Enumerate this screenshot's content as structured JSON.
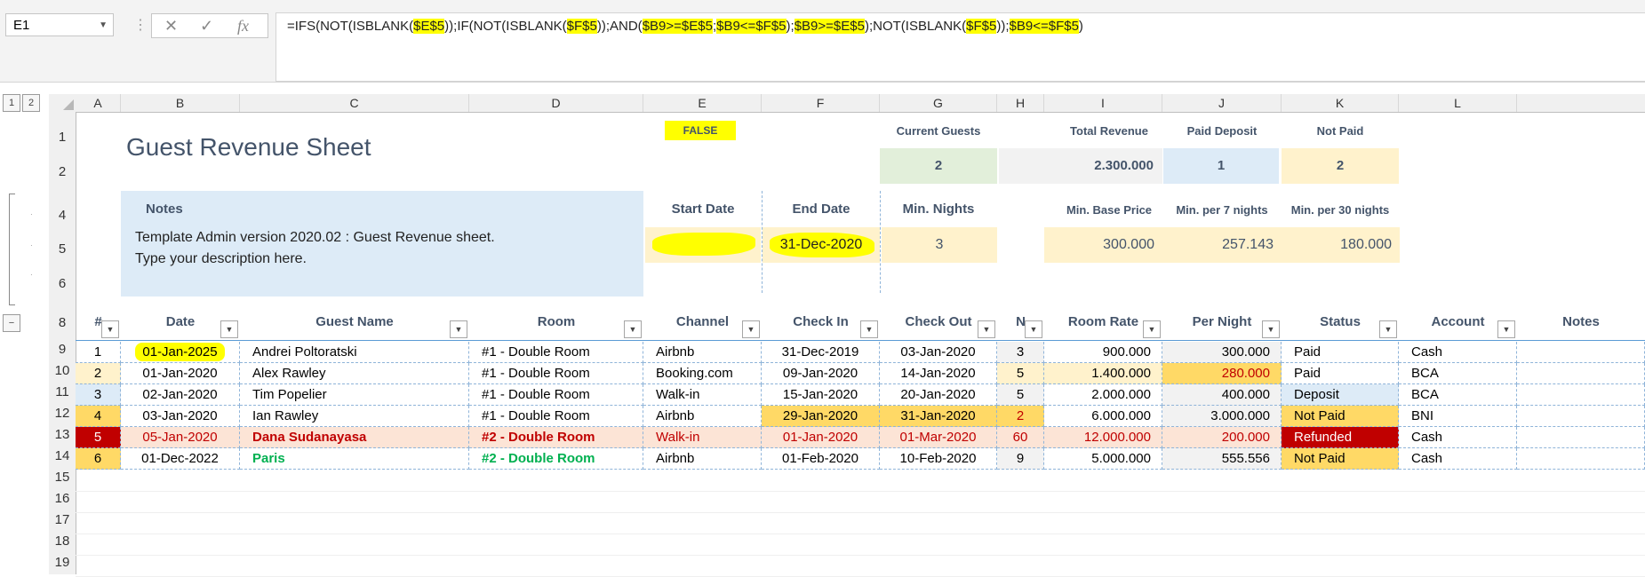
{
  "name_box": "E1",
  "formula_parts": [
    {
      "t": "=IFS(NOT(ISBLANK(",
      "h": false
    },
    {
      "t": "$E$5",
      "h": true
    },
    {
      "t": "));IF(NOT(ISBLANK(",
      "h": false
    },
    {
      "t": "$F$5",
      "h": true
    },
    {
      "t": "));AND(",
      "h": false
    },
    {
      "t": "$B9>=$E$5",
      "h": true
    },
    {
      "t": ";",
      "h": false
    },
    {
      "t": "$B9<=",
      "h": true
    },
    {
      "t": "$F$5",
      "h": true
    },
    {
      "t": ");",
      "h": false
    },
    {
      "t": "$B9>=$E$5",
      "h": true
    },
    {
      "t": ");NOT(ISBLANK(",
      "h": false
    },
    {
      "t": "$F$5",
      "h": true
    },
    {
      "t": "));",
      "h": false
    },
    {
      "t": "$B9<=$F$5",
      "h": true
    },
    {
      "t": ")",
      "h": false
    }
  ],
  "outline_levels": [
    "1",
    "2"
  ],
  "collapse_button": "−",
  "columns": [
    "A",
    "B",
    "C",
    "D",
    "E",
    "F",
    "G",
    "H",
    "I",
    "J",
    "K",
    "L"
  ],
  "rows": [
    "1",
    "2",
    "4",
    "5",
    "6",
    "8",
    "9",
    "10",
    "11",
    "12",
    "13",
    "14",
    "15",
    "16",
    "17",
    "18",
    "19"
  ],
  "sheet": {
    "title": "Guest Revenue Sheet",
    "false_flag": "FALSE",
    "summary": {
      "current_guests_label": "Current Guests",
      "current_guests": "2",
      "total_revenue_label": "Total Revenue",
      "total_revenue": "2.300.000",
      "paid_deposit_label": "Paid Deposit",
      "paid_deposit": "1",
      "not_paid_label": "Not Paid",
      "not_paid": "2"
    },
    "notes_label": "Notes",
    "notes_line1": "Template Admin version 2020.02 : Guest Revenue sheet.",
    "notes_line2": "Type your description here.",
    "start_date_label": "Start Date",
    "start_date": "",
    "end_date_label": "End Date",
    "end_date": "31-Dec-2020",
    "min_nights_label": "Min. Nights",
    "min_nights": "3",
    "min_base_price_label": "Min. Base Price",
    "min_base_price": "300.000",
    "min_7_label": "Min. per 7 nights",
    "min_7": "257.143",
    "min_30_label": "Min. per 30 nights",
    "min_30": "180.000"
  },
  "table": {
    "headers": [
      "#",
      "Date",
      "Guest Name",
      "Room",
      "Channel",
      "Check In",
      "Check Out",
      "N",
      "Room Rate",
      "Per Night",
      "Status",
      "Account",
      "Notes"
    ],
    "rows": [
      [
        "1",
        "01-Jan-2025",
        "Andrei Poltoratski",
        "#1 - Double Room",
        "Airbnb",
        "31-Dec-2019",
        "03-Jan-2020",
        "3",
        "900.000",
        "300.000",
        "Paid",
        "Cash",
        ""
      ],
      [
        "2",
        "01-Jan-2020",
        "Alex Rawley",
        "#1 - Double Room",
        "Booking.com",
        "09-Jan-2020",
        "14-Jan-2020",
        "5",
        "1.400.000",
        "280.000",
        "Paid",
        "BCA",
        ""
      ],
      [
        "3",
        "02-Jan-2020",
        "Tim Popelier",
        "#1 - Double Room",
        "Walk-in",
        "15-Jan-2020",
        "20-Jan-2020",
        "5",
        "2.000.000",
        "400.000",
        "Deposit",
        "BCA",
        ""
      ],
      [
        "4",
        "03-Jan-2020",
        "Ian Rawley",
        "#1 - Double Room",
        "Airbnb",
        "29-Jan-2020",
        "31-Jan-2020",
        "2",
        "6.000.000",
        "3.000.000",
        "Not Paid",
        "BNI",
        ""
      ],
      [
        "5",
        "05-Jan-2020",
        "Dana Sudanayasa",
        "#2 - Double Room",
        "Walk-in",
        "01-Jan-2020",
        "01-Mar-2020",
        "60",
        "12.000.000",
        "200.000",
        "Refunded",
        "Cash",
        ""
      ],
      [
        "6",
        "01-Dec-2022",
        "Paris",
        "#2 - Double Room",
        "Airbnb",
        "01-Feb-2020",
        "10-Feb-2020",
        "9",
        "5.000.000",
        "555.556",
        "Not Paid",
        "Cash",
        ""
      ]
    ]
  },
  "colors": {
    "highlight": "#ffff00",
    "green_cell": "#e2efda",
    "grey_cell": "#f2f2f2",
    "blue_cell": "#ddebf7",
    "cream_cell": "#fff2cc",
    "orange_cell": "#ffd966",
    "refund_red": "#c00000",
    "row_red_bg": "#fce4d6",
    "green_text": "#00b050"
  }
}
